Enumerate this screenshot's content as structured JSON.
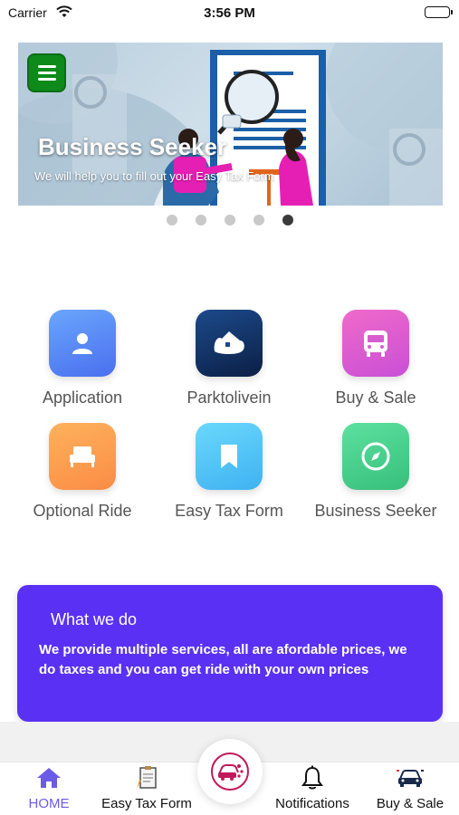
{
  "status_bar": {
    "carrier": "Carrier",
    "time": "3:56 PM"
  },
  "banner": {
    "title": "Business Seeker",
    "subtitle": "We will help you to fill out your Easy Tax  Form",
    "slide_count": 5,
    "active_slide": 5
  },
  "services": [
    {
      "label": "Application",
      "icon": "person-icon",
      "color": "#5a8cf5"
    },
    {
      "label": "Parktolivein",
      "icon": "house-icon",
      "color": "#123a6e"
    },
    {
      "label": "Buy & Sale",
      "icon": "bus-icon",
      "color": "#e25fd0"
    },
    {
      "label": "Optional Ride",
      "icon": "bed-icon",
      "color": "#fca04f"
    },
    {
      "label": "Easy Tax Form",
      "icon": "bookmark-icon",
      "color": "#50c6f4"
    },
    {
      "label": "Business Seeker",
      "icon": "compass-icon",
      "color": "#45d08a"
    }
  ],
  "what_we_do": {
    "title": "What we do",
    "body": "We provide multiple services, all are afordable prices, we do taxes and you can get ride with your own prices",
    "color": "#5a31f4"
  },
  "tab_bar": {
    "tabs": [
      {
        "label": "HOME",
        "icon": "home-icon",
        "active": true
      },
      {
        "label": "Easy Tax Form",
        "icon": "clipboard-icon",
        "active": false
      },
      {
        "label": "Notifications",
        "icon": "bell-icon",
        "active": false
      },
      {
        "label": "Buy & Sale",
        "icon": "car-icon",
        "active": false
      }
    ],
    "center_button_icon": "share-car-icon",
    "accent": "#6b5ce7"
  }
}
